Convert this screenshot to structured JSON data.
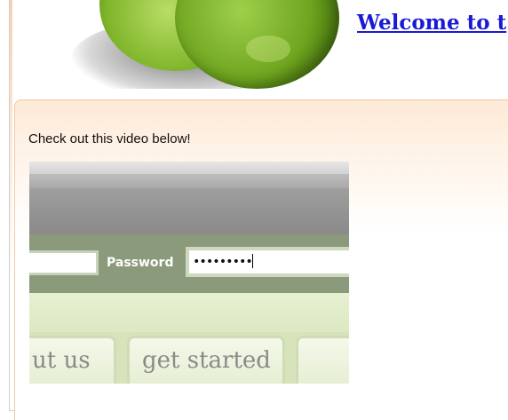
{
  "header": {
    "site_title": "Welcome to t",
    "logo_icon": "lime-image"
  },
  "main": {
    "intro_text": "Check out this video below!",
    "video": {
      "password_label": "Password",
      "password_value": "•••••••••",
      "tabs": [
        {
          "label": "ut us"
        },
        {
          "label": "get started"
        },
        {
          "label": ""
        }
      ]
    }
  },
  "colors": {
    "link": "#1a1ad6",
    "panel_border": "#f2c9a4",
    "login_bar": "#8b9a7a",
    "tab_bg": "#e6efd3"
  }
}
